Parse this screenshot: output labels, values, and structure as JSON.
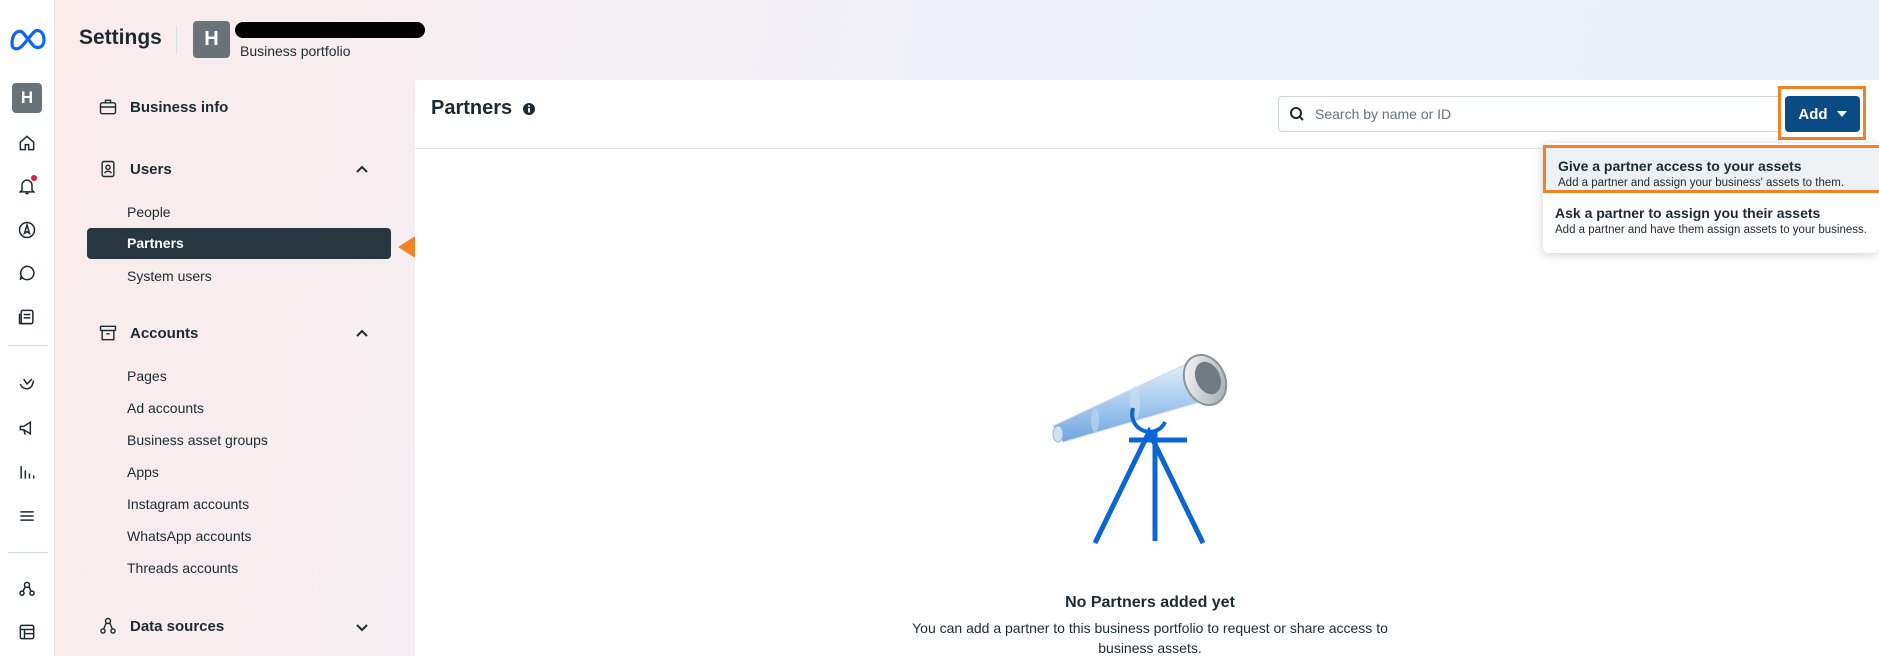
{
  "header": {
    "app_title": "Settings",
    "portfolio_initial": "H",
    "portfolio_subtitle": "Business portfolio"
  },
  "rail": {
    "avatar_initial": "H",
    "icons": [
      "home-icon",
      "notifications-icon",
      "navigate-icon",
      "messages-icon",
      "content-icon",
      "engagement-icon",
      "ads-icon",
      "insights-icon",
      "menu-icon",
      "accounts-center-icon",
      "billing-icon"
    ]
  },
  "sidebar": {
    "business_info": "Business info",
    "users": {
      "label": "Users",
      "items": [
        "People",
        "Partners",
        "System users"
      ]
    },
    "accounts": {
      "label": "Accounts",
      "items": [
        "Pages",
        "Ad accounts",
        "Business asset groups",
        "Apps",
        "Instagram accounts",
        "WhatsApp accounts",
        "Threads accounts"
      ]
    },
    "data_sources": "Data sources"
  },
  "main": {
    "title": "Partners",
    "search_placeholder": "Search by name or ID",
    "add_label": "Add",
    "menu": [
      {
        "title": "Give a partner access to your assets",
        "desc": "Add a partner and assign your business' assets to them."
      },
      {
        "title": "Ask a partner to assign you their assets",
        "desc": "Add a partner and have them assign assets to your business."
      }
    ],
    "empty_title": "No Partners added yet",
    "empty_desc": "You can add a partner to this business portfolio to request or share access to business assets."
  },
  "colors": {
    "primary": "#0a4b86",
    "highlight": "#f58220",
    "active_nav": "#283640"
  }
}
